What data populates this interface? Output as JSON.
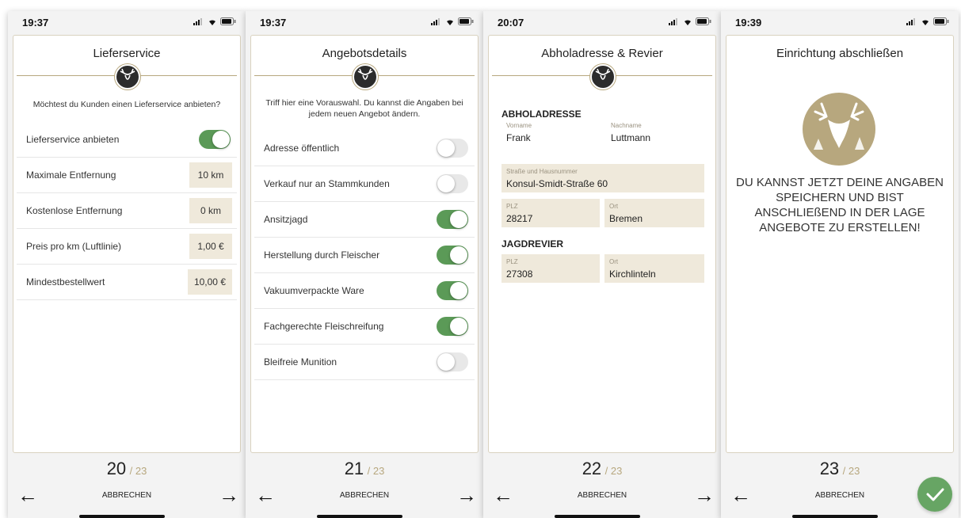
{
  "screens": [
    {
      "time": "19:37",
      "title": "Lieferservice",
      "subtitle": "Möchtest du Kunden einen Lieferservice anbieten?",
      "toggle_row": {
        "label": "Lieferservice anbieten",
        "on": true
      },
      "value_rows": [
        {
          "label": "Maximale Entfernung",
          "value": "10 km"
        },
        {
          "label": "Kostenlose Entfernung",
          "value": "0 km"
        },
        {
          "label": "Preis pro km (Luftlinie)",
          "value": "1,00 €"
        },
        {
          "label": "Mindestbestellwert",
          "value": "10,00 €"
        }
      ],
      "step": "20",
      "total": "/ 23",
      "cancel": "ABBRECHEN"
    },
    {
      "time": "19:37",
      "title": "Angebotsdetails",
      "subtitle": "Triff hier eine Vorauswahl. Du kannst die Angaben bei jedem neuen Angebot ändern.",
      "toggles": [
        {
          "label": "Adresse öffentlich",
          "on": false
        },
        {
          "label": "Verkauf nur an Stammkunden",
          "on": false
        },
        {
          "label": "Ansitzjagd",
          "on": true
        },
        {
          "label": "Herstellung durch Fleischer",
          "on": true
        },
        {
          "label": "Vakuumverpackte Ware",
          "on": true
        },
        {
          "label": "Fachgerechte Fleischreifung",
          "on": true
        },
        {
          "label": "Bleifreie Munition",
          "on": false
        }
      ],
      "step": "21",
      "total": "/ 23",
      "cancel": "ABBRECHEN"
    },
    {
      "time": "20:07",
      "title": "Abholadresse & Revier",
      "section_pickup": "ABHOLADRESSE",
      "first_name_label": "Vorname",
      "first_name": "Frank",
      "last_name_label": "Nachname",
      "last_name": "Luttmann",
      "street_label": "Straße und Hausnummer",
      "street": "Konsul-Smidt-Straße 60",
      "plz_label": "PLZ",
      "plz": "28217",
      "city_label": "Ort",
      "city": "Bremen",
      "section_hunting": "JAGDREVIER",
      "hunt_plz_label": "PLZ",
      "hunt_plz": "27308",
      "hunt_city_label": "Ort",
      "hunt_city": "Kirchlinteln",
      "step": "22",
      "total": "/ 23",
      "cancel": "ABBRECHEN"
    },
    {
      "time": "19:39",
      "title": "Einrichtung abschließen",
      "message": "DU KANNST JETZT DEINE ANGABEN SPEICHERN UND BIST ANSCHLIEßEND IN DER LAGE ANGEBOTE ZU ERSTELLEN!",
      "step": "23",
      "total": "/ 23",
      "cancel": "ABBRECHEN"
    }
  ],
  "colors": {
    "accent": "#b7a77e",
    "toggle_on": "#5b9a57",
    "field_bg": "#efe9db",
    "confirm": "#67a564"
  },
  "icons": {
    "back": "←",
    "next": "→",
    "confirm": "check-icon",
    "logo": "deer-head-icon"
  }
}
